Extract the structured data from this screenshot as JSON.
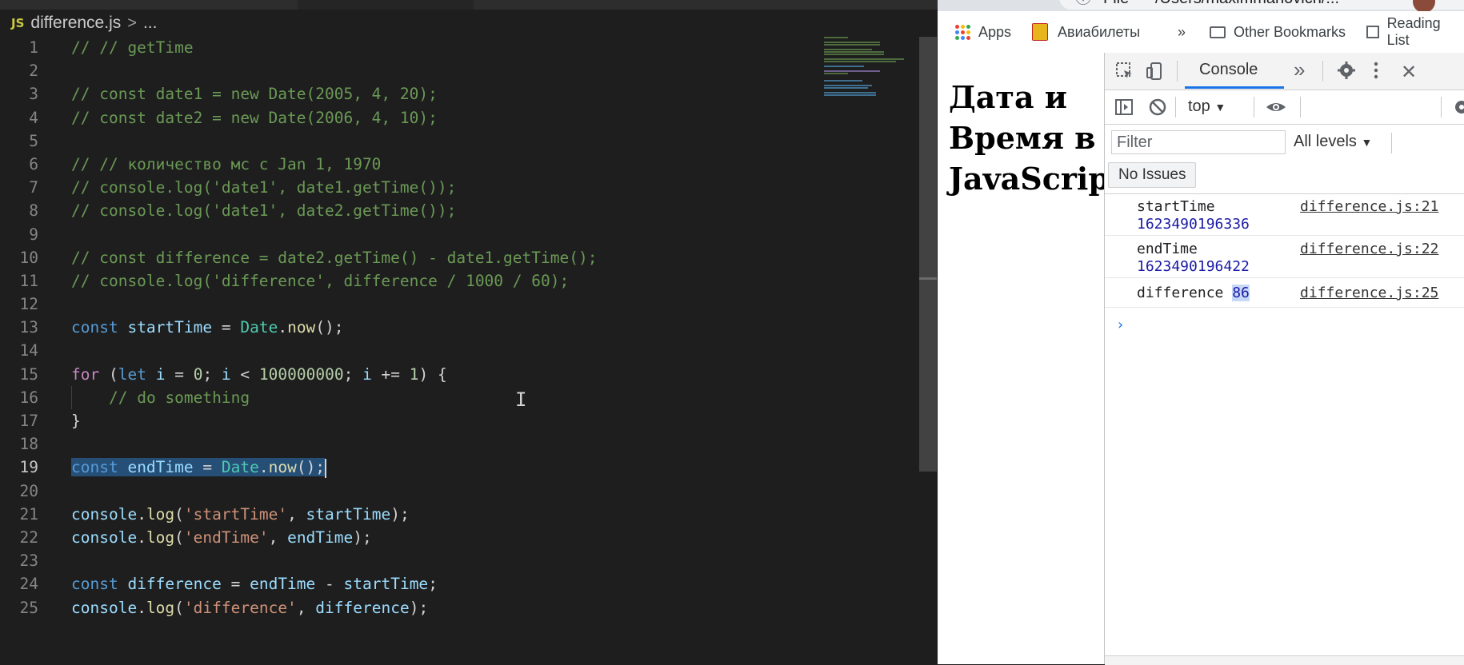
{
  "editor": {
    "file_badge": "JS",
    "filename": "difference.js",
    "breadcrumb_sep": ">",
    "breadcrumb_more": "...",
    "line_numbers": [
      "1",
      "2",
      "3",
      "4",
      "5",
      "6",
      "7",
      "8",
      "9",
      "10",
      "11",
      "12",
      "13",
      "14",
      "15",
      "16",
      "17",
      "18",
      "19",
      "20",
      "21",
      "22",
      "23",
      "24",
      "25"
    ],
    "active_line": "19",
    "lines": {
      "l1": "// // getTime",
      "l3": "// const date1 = new Date(2005, 4, 20);",
      "l4": "// const date2 = new Date(2006, 4, 10);",
      "l6": "// // количество мс с Jan 1, 1970",
      "l7": "// console.log('date1', date1.getTime());",
      "l8": "// console.log('date1', date2.getTime());",
      "l10": "// const difference = date2.getTime() - date1.getTime();",
      "l11": "// console.log('difference', difference / 1000 / 60);",
      "l16": "// do something",
      "tokens": {
        "const": "const",
        "let": "let",
        "for": "for",
        "startTime": "startTime",
        "endTime": "endTime",
        "difference": "difference",
        "Date": "Date",
        "now": "now",
        "console": "console",
        "log": "log",
        "i": "i",
        "zero": "0",
        "limit": "100000000",
        "one": "1",
        "str_start": "'startTime'",
        "str_end": "'endTime'",
        "str_diff": "'difference'"
      }
    }
  },
  "browser": {
    "url_file": "File",
    "url_path": "/Users/maximmanovich/...",
    "bookmarks": {
      "apps": "Apps",
      "avia": "Авиабилеты",
      "more": "»",
      "other": "Other Bookmarks",
      "reading": "Reading List"
    },
    "page_title": "Дата и Время в JavaScript"
  },
  "devtools": {
    "console_tab": "Console",
    "more_tabs": "»",
    "context": "top",
    "filter_placeholder": "Filter",
    "levels": "All levels",
    "no_issues": "No Issues",
    "messages": [
      {
        "label": "startTime",
        "value": "1623490196336",
        "source": "difference.js:21"
      },
      {
        "label": "endTime",
        "value": "1623490196422",
        "source": "difference.js:22"
      },
      {
        "label": "difference",
        "value": "86",
        "source": "difference.js:25"
      }
    ],
    "prompt": "›"
  }
}
